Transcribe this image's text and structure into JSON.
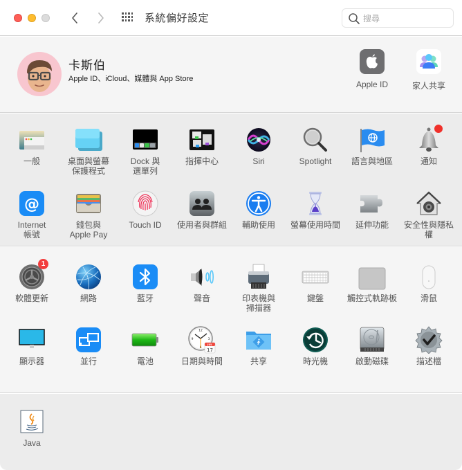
{
  "window": {
    "title": "系統偏好設定",
    "search_placeholder": "搜尋",
    "search_value": ""
  },
  "account": {
    "name": "卡斯伯",
    "subtitle": "Apple ID、iCloud、媒體與 App Store",
    "items": [
      {
        "label": "Apple ID",
        "icon": "apple-logo-icon"
      },
      {
        "label": "家人共享",
        "icon": "family-sharing-icon"
      }
    ]
  },
  "sections": [
    {
      "rows": [
        [
          {
            "label": "一般",
            "icon": "general-icon"
          },
          {
            "label": "桌面與螢幕\n保護程式",
            "icon": "desktop-screensaver-icon"
          },
          {
            "label": "Dock 與\n選單列",
            "icon": "dock-icon"
          },
          {
            "label": "指揮中心",
            "icon": "mission-control-icon"
          },
          {
            "label": "Siri",
            "icon": "siri-icon"
          },
          {
            "label": "Spotlight",
            "icon": "spotlight-icon"
          },
          {
            "label": "語言與地區",
            "icon": "language-region-icon"
          },
          {
            "label": "通知",
            "icon": "notifications-icon",
            "dot": true
          }
        ],
        [
          {
            "label": "Internet\n帳號",
            "icon": "internet-accounts-icon"
          },
          {
            "label": "錢包與\nApple Pay",
            "icon": "wallet-icon"
          },
          {
            "label": "Touch ID",
            "icon": "touch-id-icon"
          },
          {
            "label": "使用者與群組",
            "icon": "users-groups-icon"
          },
          {
            "label": "輔助使用",
            "icon": "accessibility-icon"
          },
          {
            "label": "螢幕使用時間",
            "icon": "screen-time-icon"
          },
          {
            "label": "延伸功能",
            "icon": "extensions-icon"
          },
          {
            "label": "安全性與隱私權",
            "icon": "security-privacy-icon"
          }
        ]
      ]
    },
    {
      "rows": [
        [
          {
            "label": "軟體更新",
            "icon": "software-update-icon",
            "badge": "1"
          },
          {
            "label": "網路",
            "icon": "network-icon"
          },
          {
            "label": "藍牙",
            "icon": "bluetooth-icon"
          },
          {
            "label": "聲音",
            "icon": "sound-icon"
          },
          {
            "label": "印表機與\n掃描器",
            "icon": "printer-icon"
          },
          {
            "label": "鍵盤",
            "icon": "keyboard-icon"
          },
          {
            "label": "觸控式軌跡板",
            "icon": "trackpad-icon"
          },
          {
            "label": "滑鼠",
            "icon": "mouse-icon"
          }
        ],
        [
          {
            "label": "顯示器",
            "icon": "displays-icon"
          },
          {
            "label": "並行",
            "icon": "sidecar-icon"
          },
          {
            "label": "電池",
            "icon": "battery-icon"
          },
          {
            "label": "日期與時間",
            "icon": "date-time-icon",
            "calendar_month": "JUL",
            "calendar_day": "17"
          },
          {
            "label": "共享",
            "icon": "sharing-icon"
          },
          {
            "label": "時光機",
            "icon": "time-machine-icon"
          },
          {
            "label": "啟動磁碟",
            "icon": "startup-disk-icon"
          },
          {
            "label": "描述檔",
            "icon": "profiles-icon"
          }
        ]
      ]
    },
    {
      "rows": [
        [
          {
            "label": "Java",
            "icon": "java-icon"
          }
        ]
      ]
    }
  ]
}
